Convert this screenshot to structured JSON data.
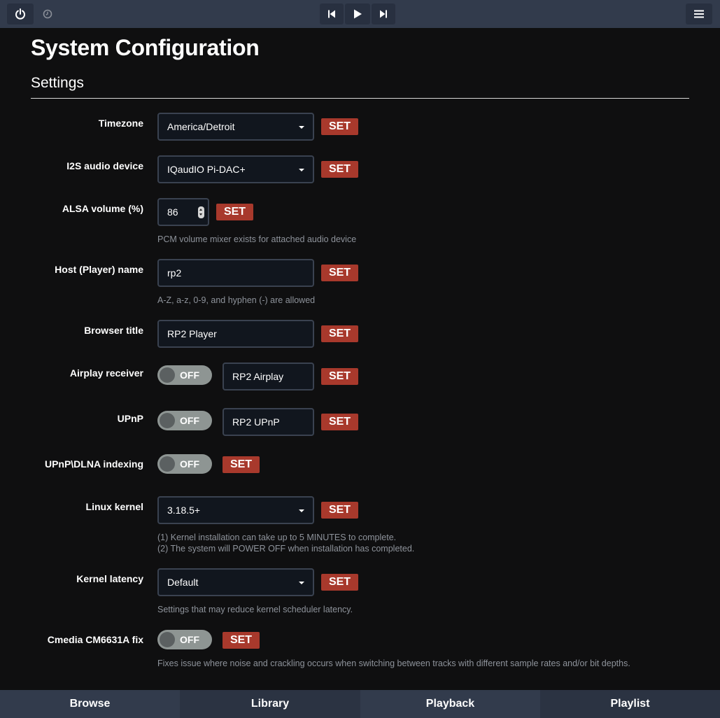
{
  "topbar": {
    "power_icon": "power-icon",
    "clock_icon": "clock-icon",
    "prev_icon": "skip-back-icon",
    "play_icon": "play-icon",
    "next_icon": "skip-forward-icon",
    "menu_icon": "hamburger-menu-icon"
  },
  "page": {
    "title": "System Configuration",
    "section": "Settings"
  },
  "settings": {
    "timezone": {
      "label": "Timezone",
      "value": "America/Detroit",
      "button": "SET"
    },
    "i2s": {
      "label": "I2S audio device",
      "value": "IQaudIO Pi-DAC+",
      "button": "SET"
    },
    "alsa": {
      "label": "ALSA volume (%)",
      "value": "86",
      "button": "SET",
      "help": "PCM volume mixer exists for attached audio device"
    },
    "host": {
      "label": "Host (Player) name",
      "value": "rp2",
      "button": "SET",
      "help": "A-Z, a-z, 0-9, and hyphen (-) are allowed"
    },
    "browser": {
      "label": "Browser title",
      "value": "RP2 Player",
      "button": "SET"
    },
    "airplay": {
      "label": "Airplay receiver",
      "toggle": "OFF",
      "value": "RP2 Airplay",
      "button": "SET"
    },
    "upnp": {
      "label": "UPnP",
      "toggle": "OFF",
      "value": "RP2 UPnP",
      "button": "SET"
    },
    "dlna": {
      "label": "UPnP\\DLNA indexing",
      "toggle": "OFF",
      "button": "SET"
    },
    "kernel": {
      "label": "Linux kernel",
      "value": "3.18.5+",
      "button": "SET",
      "help1": "(1) Kernel installation can take up to 5 MINUTES to complete.",
      "help2": "(2) The system will POWER OFF when installation has completed."
    },
    "latency": {
      "label": "Kernel latency",
      "value": "Default",
      "button": "SET",
      "help": "Settings that may reduce kernel scheduler latency."
    },
    "cmedia": {
      "label": "Cmedia CM6631A fix",
      "toggle": "OFF",
      "button": "SET",
      "help": "Fixes issue where noise and crackling occurs when switching between tracks with different sample rates and/or bit depths."
    }
  },
  "bottom_nav": {
    "browse": "Browse",
    "library": "Library",
    "playback": "Playback",
    "playlist": "Playlist"
  },
  "colors": {
    "bar": "#323b4c",
    "set_button": "#a8392c",
    "toggle_off": "#8e9593"
  }
}
